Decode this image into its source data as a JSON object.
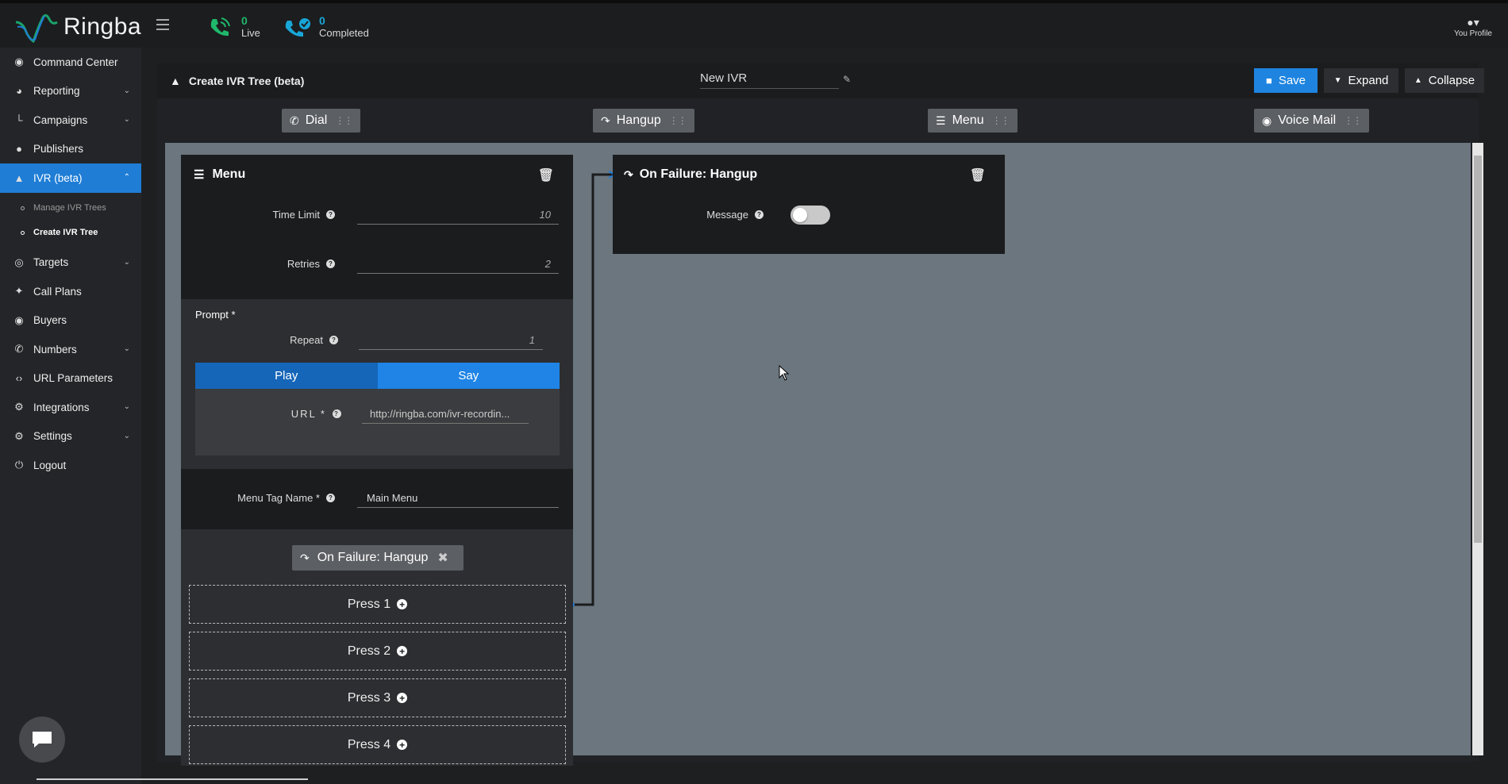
{
  "app": {
    "brand": "Ringba",
    "accent_color": "#1f7dd6",
    "live_count": "0",
    "live_label": "Live",
    "completed_count": "0",
    "completed_label": "Completed",
    "profile_label": "You Profile"
  },
  "sidebar": {
    "items": [
      {
        "label": "Command Center",
        "icon": "dashboard-icon"
      },
      {
        "label": "Reporting",
        "icon": "pie-chart-icon"
      },
      {
        "label": "Campaigns",
        "icon": "sitemap-icon"
      },
      {
        "label": "Publishers",
        "icon": "users-icon"
      },
      {
        "label": "IVR (beta)",
        "icon": "tree-icon"
      },
      {
        "label": "Targets",
        "icon": "target-icon"
      },
      {
        "label": "Call Plans",
        "icon": "plug-icon"
      },
      {
        "label": "Buyers",
        "icon": "coins-icon"
      },
      {
        "label": "Numbers",
        "icon": "phone-icon"
      },
      {
        "label": "URL Parameters",
        "icon": "code-icon"
      },
      {
        "label": "Integrations",
        "icon": "cogs-icon"
      },
      {
        "label": "Settings",
        "icon": "gear-icon"
      },
      {
        "label": "Logout",
        "icon": "power-icon"
      }
    ],
    "subitems": [
      {
        "label": "Manage IVR Trees"
      },
      {
        "label": "Create IVR Tree"
      }
    ]
  },
  "panel": {
    "title": "Create IVR Tree (beta)",
    "ivr_name": "New IVR",
    "save_label": "Save",
    "expand_label": "Expand",
    "collapse_label": "Collapse"
  },
  "toolbox": {
    "dial": "Dial",
    "hangup": "Hangup",
    "menu": "Menu",
    "voicemail": "Voice Mail"
  },
  "menu_node": {
    "title": "Menu",
    "time_limit_label": "Time Limit",
    "time_limit_value": "10",
    "retries_label": "Retries",
    "retries_value": "2",
    "prompt_label": "Prompt *",
    "repeat_label": "Repeat",
    "repeat_value": "1",
    "play_label": "Play",
    "say_label": "Say",
    "url_label": "URL *",
    "url_value": "http://ringba.com/ivr-recordin...",
    "tag_label": "Menu Tag Name *",
    "tag_value": "Main Menu",
    "failure_chip": "On Failure: Hangup",
    "press_options": [
      "Press 1",
      "Press 2",
      "Press 3",
      "Press 4"
    ]
  },
  "hangup_node": {
    "title": "On Failure: Hangup",
    "message_label": "Message",
    "message_enabled": false
  }
}
